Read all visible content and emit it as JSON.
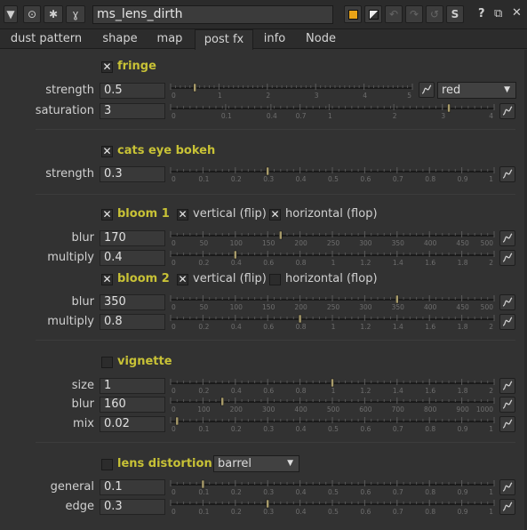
{
  "node": {
    "name": "ms_lens_dirth"
  },
  "tabs": [
    "dust pattern",
    "shape",
    "map",
    "post fx",
    "info",
    "Node"
  ],
  "active_tab": "post fx",
  "fringe": {
    "label": "fringe",
    "checked": true,
    "strength": {
      "label": "strength",
      "value": "0.5"
    },
    "saturation": {
      "label": "saturation",
      "value": "3"
    },
    "color_select": "red"
  },
  "cats_eye": {
    "label": "cats eye bokeh",
    "checked": true,
    "strength": {
      "label": "strength",
      "value": "0.3"
    }
  },
  "bloom1": {
    "label": "bloom 1",
    "checked": true,
    "vflip_label": "vertical (flip)",
    "vflip": true,
    "hflop_label": "horizontal (flop)",
    "hflop": true,
    "blur": {
      "label": "blur",
      "value": "170"
    },
    "multiply": {
      "label": "multiply",
      "value": "0.4"
    }
  },
  "bloom2": {
    "label": "bloom 2",
    "checked": true,
    "vflip_label": "vertical (flip)",
    "vflip": true,
    "hflop_label": "horizontal (flop)",
    "hflop": false,
    "blur": {
      "label": "blur",
      "value": "350"
    },
    "multiply": {
      "label": "multiply",
      "value": "0.8"
    }
  },
  "vignette": {
    "label": "vignette",
    "checked": false,
    "size": {
      "label": "size",
      "value": "1"
    },
    "blur": {
      "label": "blur",
      "value": "160"
    },
    "mix": {
      "label": "mix",
      "value": "0.02"
    }
  },
  "lens_distortion": {
    "label": "lens distortion",
    "checked": false,
    "mode": "barrel",
    "general": {
      "label": "general",
      "value": "0.1"
    },
    "edge": {
      "label": "edge",
      "value": "0.3"
    }
  },
  "ticks": {
    "fringe_strength": [
      "0",
      "1",
      "2",
      "3",
      "4",
      "5"
    ],
    "saturation": [
      "0",
      "0.1",
      "0.4",
      "0.7",
      "1",
      "2",
      "3",
      "4"
    ],
    "unit": [
      "0",
      "0.1",
      "0.2",
      "0.3",
      "0.4",
      "0.5",
      "0.6",
      "0.7",
      "0.8",
      "0.9",
      "1"
    ],
    "blur500": [
      "0",
      "50",
      "100",
      "150",
      "200",
      "250",
      "300",
      "350",
      "400",
      "450",
      "500"
    ],
    "mult2": [
      "0",
      "0.2",
      "0.4",
      "0.6",
      "0.8",
      "1",
      "1.2",
      "1.4",
      "1.6",
      "1.8",
      "2"
    ],
    "blur1000": [
      "0",
      "100",
      "200",
      "300",
      "400",
      "500",
      "600",
      "700",
      "800",
      "900",
      "1000"
    ]
  },
  "colors": {
    "accent": "#c8c236",
    "background": "#323232",
    "orange_button": "#e8a317"
  },
  "icons": [
    "collapse-arrow-icon",
    "settings-gear-icon",
    "plugin-icon",
    "wrench-icon",
    "color-swatch-icon",
    "edit-icon",
    "undo-icon",
    "redo-icon",
    "revert-icon",
    "s-icon",
    "help-icon",
    "float-icon",
    "close-icon",
    "curve-icon"
  ]
}
